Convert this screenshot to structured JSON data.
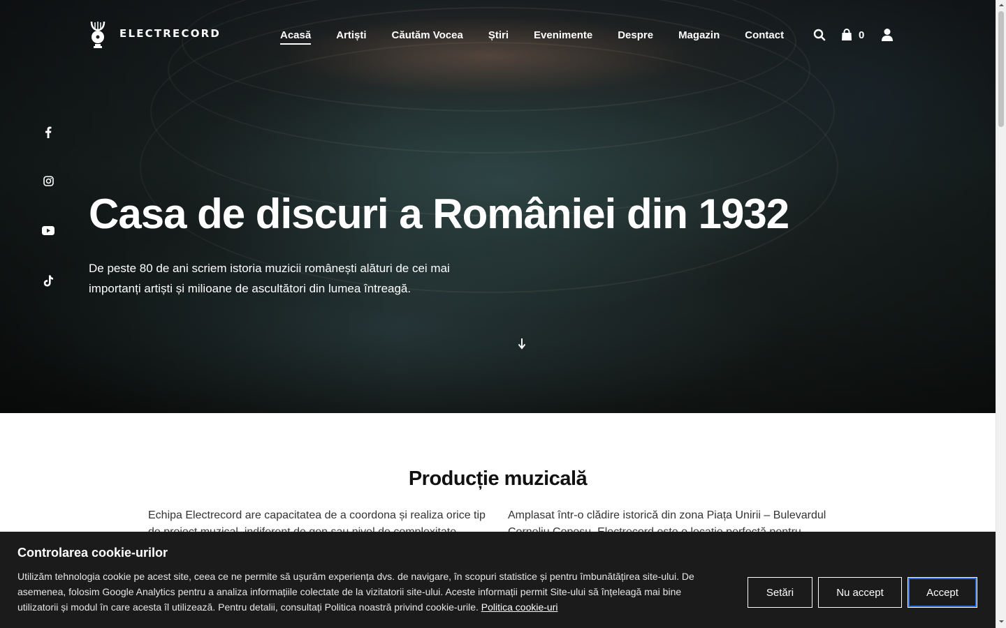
{
  "header": {
    "logo_text": "ELECTRECORD",
    "nav": [
      {
        "label": "Acasă",
        "active": true
      },
      {
        "label": "Artiști"
      },
      {
        "label": "Căutăm Vocea"
      },
      {
        "label": "Știri"
      },
      {
        "label": "Evenimente"
      },
      {
        "label": "Despre"
      },
      {
        "label": "Magazin"
      },
      {
        "label": "Contact"
      }
    ],
    "cart_count": "0",
    "icons": [
      "search-icon",
      "shopping-bag-icon",
      "user-icon"
    ]
  },
  "social": [
    "facebook-icon",
    "instagram-icon",
    "youtube-icon",
    "tiktok-icon"
  ],
  "hero": {
    "title": "Casa de discuri a României din 1932",
    "subtitle": "De peste 80 de ani scriem istoria muzicii românești alături de cei mai importanți artiști și milioane de ascultători din lumea întreagă."
  },
  "production": {
    "title": "Producție muzicală",
    "left_text": "Echipa Electrecord are capacitatea de a coordona și realiza orice tip de proiect muzical, indiferent de gen sau nivel de complexitate. Studioul",
    "right_text": "Amplasat într-o clădire istorică din zona Piața Unirii – Bulevardul Corneliu Coposu, Electrecord este o locație perfectă pentru proiectele"
  },
  "cookie": {
    "title": "Controlarea cookie-urilor",
    "text": "Utilizăm tehnologia cookie pe acest site, ceea ce ne permite să ușurăm experiența dvs. de navigare, în scopuri statistice și pentru îmbunătățirea site-ului. De asemenea, folosim Google Analytics pentru a analiza informațiile colectate de la vizitatorii site-ului. Aceste informații permit Site-ului să înțeleagă mai bine utilizatorii și modul în care acesta îl utilizează. Pentru detalii, consultați Politica noastră privind cookie-urile.",
    "link": "Politica cookie-uri",
    "settings_label": "Setări",
    "reject_label": "Nu accept",
    "accept_label": "Accept",
    "accent_color": "#2b6de0"
  }
}
